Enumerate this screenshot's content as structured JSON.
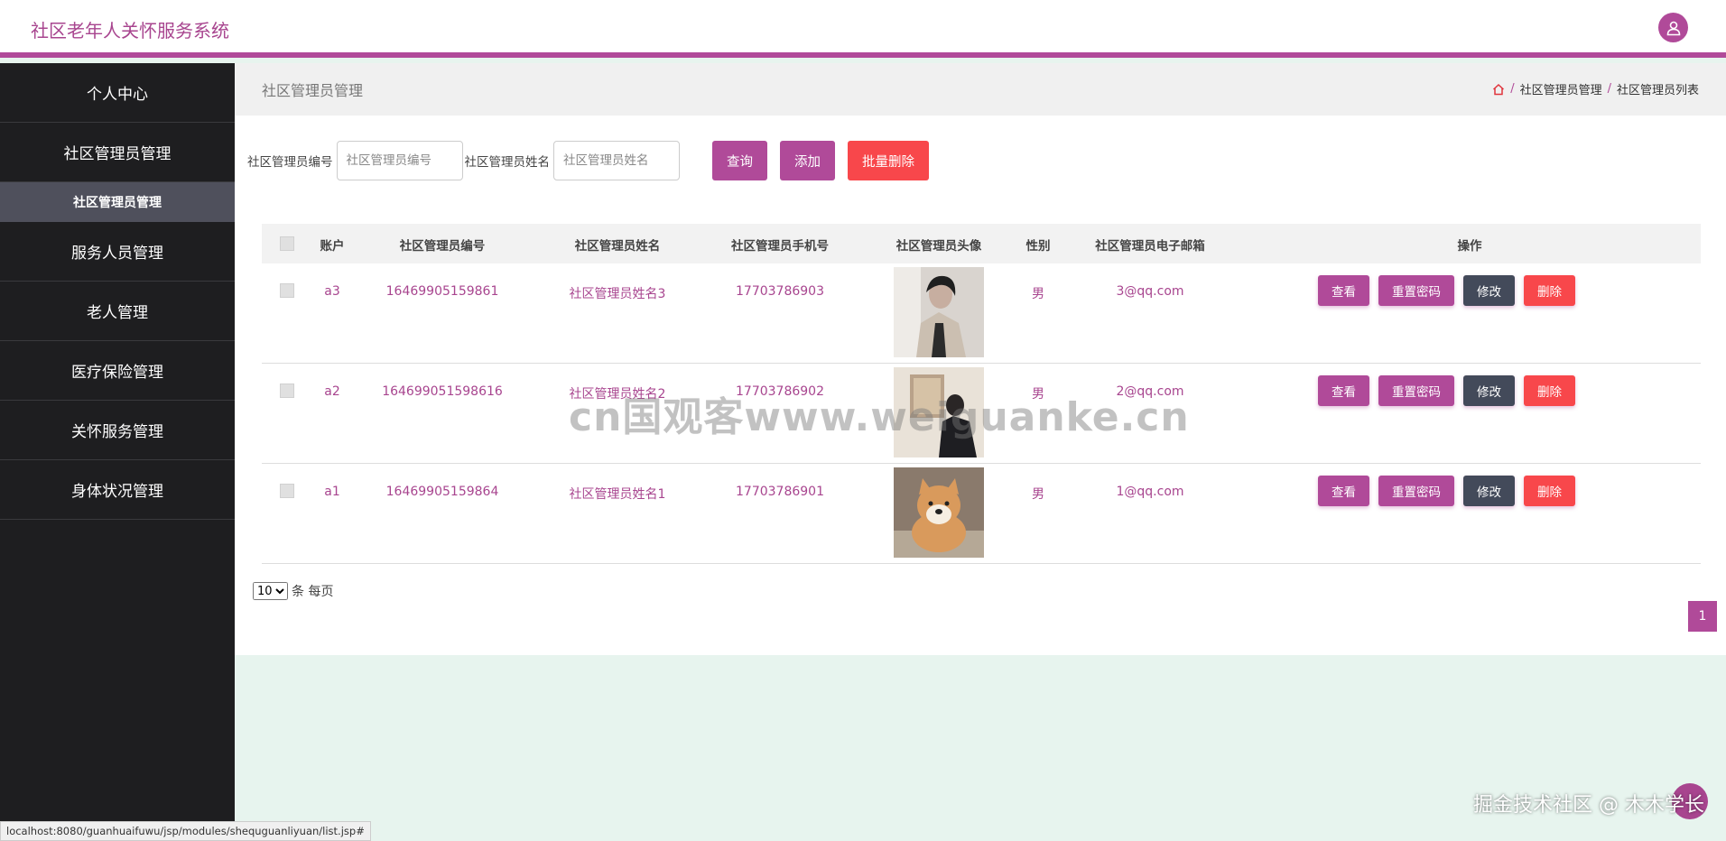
{
  "app": {
    "title": "社区老年人关怀服务系统"
  },
  "sidebar": {
    "items": [
      {
        "label": "个人中心"
      },
      {
        "label": "社区管理员管理",
        "sub": "社区管理员管理"
      },
      {
        "label": "服务人员管理"
      },
      {
        "label": "老人管理"
      },
      {
        "label": "医疗保险管理"
      },
      {
        "label": "关怀服务管理"
      },
      {
        "label": "身体状况管理"
      }
    ]
  },
  "breadcrumb": {
    "title": "社区管理员管理",
    "level1": "社区管理员管理",
    "level2": "社区管理员列表",
    "sep": "/"
  },
  "filters": {
    "id_label": "社区管理员编号",
    "id_placeholder": "社区管理员编号",
    "name_label": "社区管理员姓名",
    "name_placeholder": "社区管理员姓名",
    "query": "查询",
    "add": "添加",
    "batch_delete": "批量删除"
  },
  "table": {
    "headers": [
      "账户",
      "社区管理员编号",
      "社区管理员姓名",
      "社区管理员手机号",
      "社区管理员头像",
      "性别",
      "社区管理员电子邮箱",
      "操作"
    ],
    "rows": [
      {
        "account": "a3",
        "id": "16469905159861",
        "name": "社区管理员姓名3",
        "phone": "17703786903",
        "gender": "男",
        "email": "3@qq.com",
        "photo": "portrait-man"
      },
      {
        "account": "a2",
        "id": "164699051598616",
        "name": "社区管理员姓名2",
        "phone": "17703786902",
        "gender": "男",
        "email": "2@qq.com",
        "photo": "portrait-room"
      },
      {
        "account": "a1",
        "id": "16469905159864",
        "name": "社区管理员姓名1",
        "phone": "17703786901",
        "gender": "男",
        "email": "1@qq.com",
        "photo": "shiba-dog"
      }
    ],
    "actions": {
      "view": "查看",
      "reset": "重置密码",
      "edit": "修改",
      "delete": "删除"
    }
  },
  "pager": {
    "size": "10",
    "suffix": "条 每页",
    "page": "1"
  },
  "status_url": "localhost:8080/guanhuaifuwu/jsp/modules/shequguanliyuan/list.jsp#",
  "watermark": {
    "center": "cn国观客www.weiguanke.cn",
    "corner": "掘金技术社区 @ 木木学长"
  },
  "colors": {
    "accent": "#b04a99",
    "danger": "#f8474b",
    "dark_button": "#434a5a",
    "sidebar": "#1e1e20"
  }
}
